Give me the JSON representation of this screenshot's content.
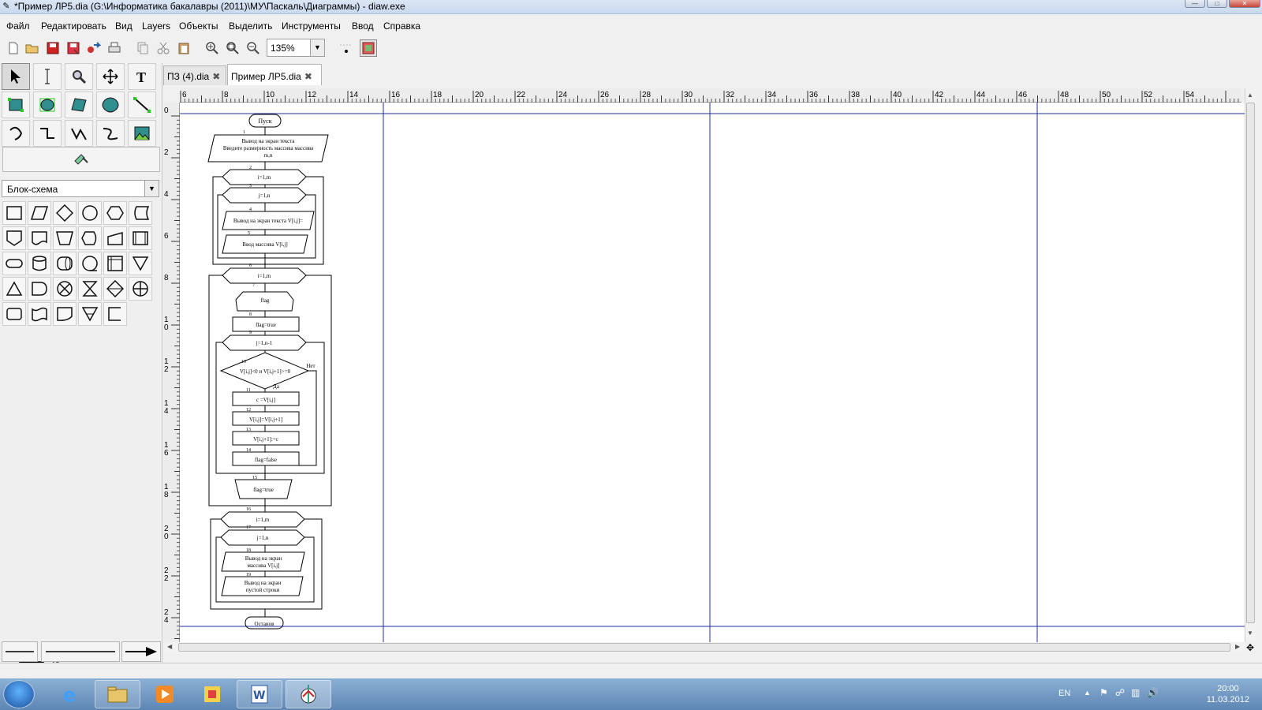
{
  "window": {
    "title": "*Пример ЛР5.dia (G:\\Информатика бакалавры (2011)\\МУ\\Паскаль\\Диаграммы) - diaw.exe"
  },
  "menu": [
    "Файл",
    "Редактировать",
    "Вид",
    "Layers",
    "Объекты",
    "Выделить",
    "Инструменты",
    "Ввод",
    "Справка"
  ],
  "toolbar": {
    "zoom": "135%"
  },
  "sheet": {
    "selected": "Блок-схема"
  },
  "tabs": [
    {
      "label": "ПЗ (4).dia",
      "active": false
    },
    {
      "label": "Пример ЛР5.dia",
      "active": true
    }
  ],
  "rulers": {
    "horizontal": [
      "6",
      "8",
      "10",
      "12",
      "14",
      "16",
      "18",
      "20",
      "22",
      "24",
      "26",
      "28",
      "30",
      "32",
      "34",
      "36",
      "38",
      "40",
      "42",
      "44",
      "46",
      "48",
      "50",
      "52",
      "54"
    ],
    "vertical": [
      [
        "0"
      ],
      [
        "2"
      ],
      [
        "4"
      ],
      [
        "6"
      ],
      [
        "8"
      ],
      [
        "1",
        "0"
      ],
      [
        "1",
        "2"
      ],
      [
        "1",
        "4"
      ],
      [
        "1",
        "6"
      ],
      [
        "1",
        "8"
      ],
      [
        "2",
        "0"
      ],
      [
        "2",
        "2"
      ],
      [
        "2",
        "4"
      ]
    ]
  },
  "flowchart": {
    "start": "Пуск",
    "stop": "Останов",
    "labels": {
      "b1": [
        "Вывод на экран текста",
        "Введите размерность массива массива",
        "m,n"
      ],
      "b2": "i=1,m",
      "b3": "j=1,n",
      "b4": "Вывод на экран текста  V[i,j]=",
      "b5": "Ввод массива  V[i,j]",
      "b6": "i=1,m",
      "b7": "flag",
      "b8": "flag=true",
      "b9": "j=1,n-1",
      "b10": "V[i,j]<0 и V[i,j+1]>=0",
      "b10_no": "Нет",
      "b10_yes": "Да",
      "b11": "c =V[i,j]",
      "b12": "V[i,j]=V[i,j+1]",
      "b13": "V[i,j+1]:=c",
      "b14": "flag=false",
      "b15": "flag=true",
      "b16": "i=1,m",
      "b17": "j=1,n",
      "b18": [
        "Вывод на экран",
        "массива V[i,j]"
      ],
      "b19": [
        "Вывод на экран",
        "пустой строки"
      ]
    },
    "numbers": [
      "1",
      "2",
      "3",
      "4",
      "5",
      "6",
      "7",
      "8",
      "9",
      "10",
      "11",
      "12",
      "13",
      "14",
      "15",
      "16",
      "17",
      "18",
      "19"
    ]
  },
  "taskbar": {
    "lang": "EN",
    "time": "20:00",
    "date": "11.03.2012"
  }
}
